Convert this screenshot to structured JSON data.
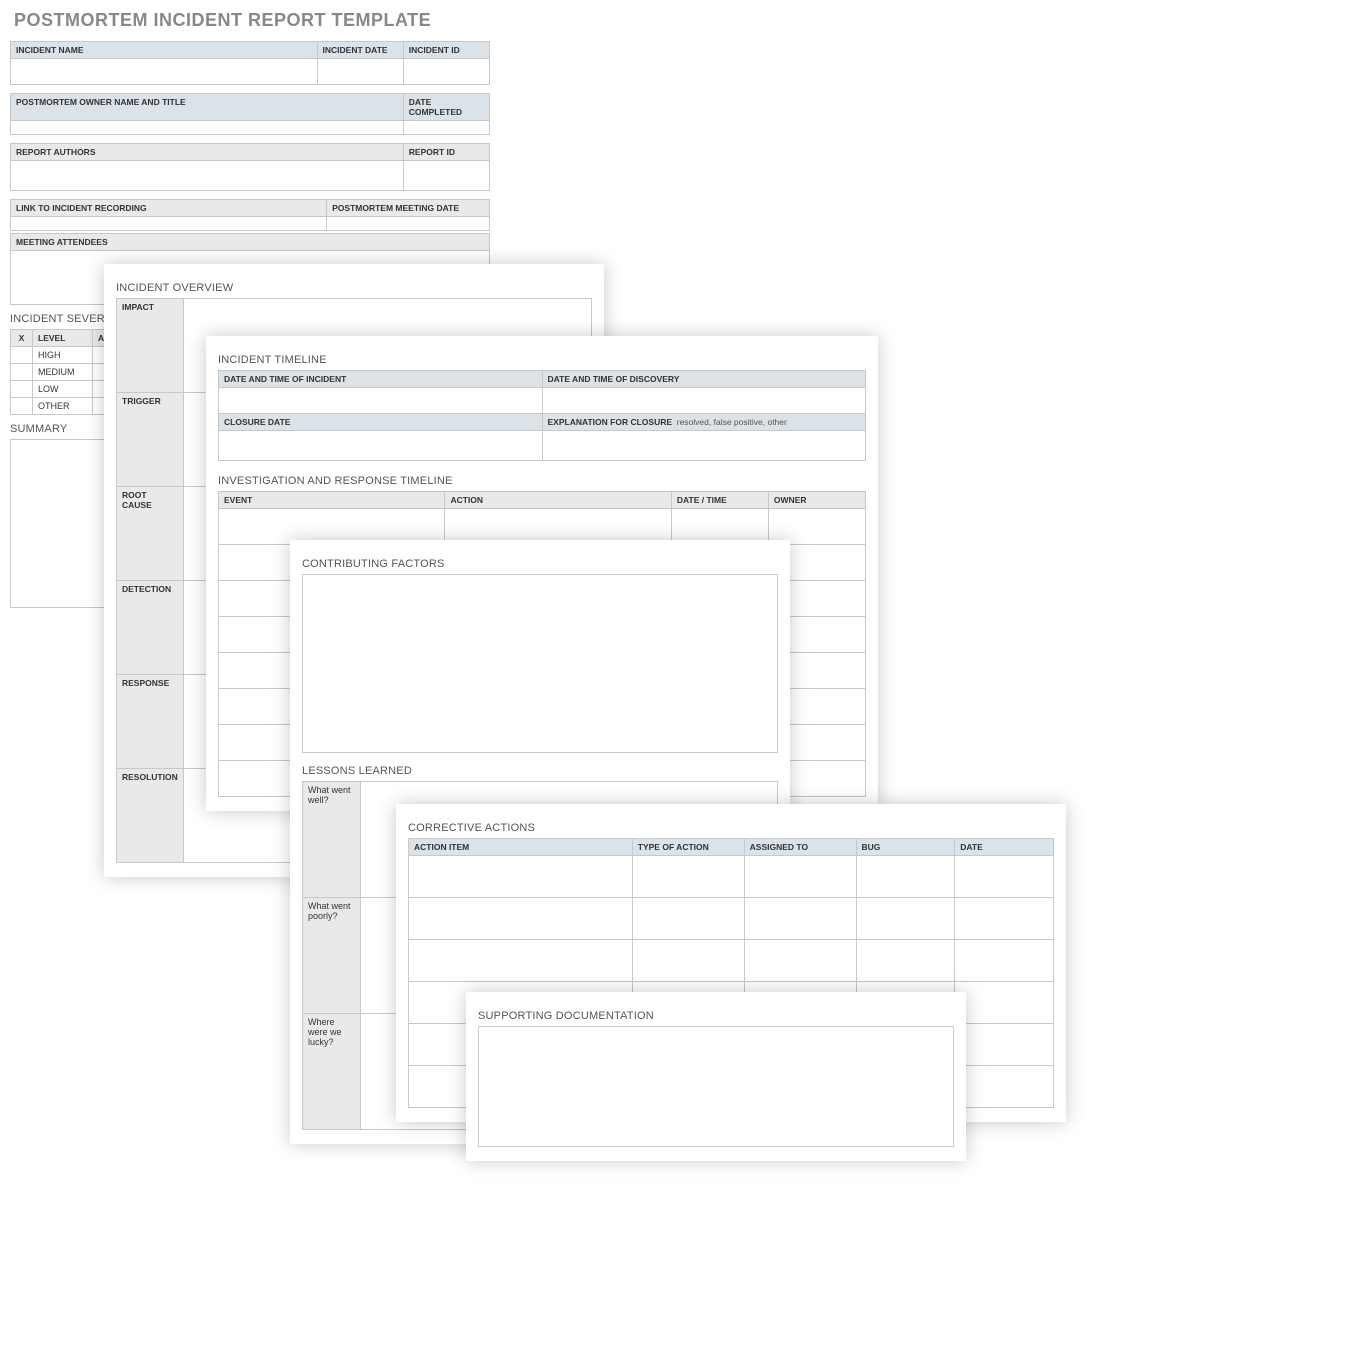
{
  "title": "POSTMORTEM INCIDENT REPORT TEMPLATE",
  "page1": {
    "incidentName": "INCIDENT NAME",
    "incidentDate": "INCIDENT DATE",
    "incidentId": "INCIDENT ID",
    "ownerName": "POSTMORTEM OWNER NAME AND TITLE",
    "dateCompleted": "DATE COMPLETED",
    "reportAuthors": "REPORT AUTHORS",
    "reportId": "REPORT ID",
    "linkRecording": "LINK TO INCIDENT RECORDING",
    "meetingDate": "POSTMORTEM MEETING DATE",
    "attendees": "MEETING ATTENDEES",
    "severityHeader": "INCIDENT SEVERITY",
    "sev": {
      "x": "X",
      "level": "LEVEL",
      "add": "ADD",
      "high": "HIGH",
      "medium": "MEDIUM",
      "low": "LOW",
      "other": "OTHER"
    },
    "summary": "SUMMARY"
  },
  "page2": {
    "header": "INCIDENT OVERVIEW",
    "impact": "IMPACT",
    "trigger": "TRIGGER",
    "rootCause": "ROOT CAUSE",
    "detection": "DETECTION",
    "response": "RESPONSE",
    "resolution": "RESOLUTION"
  },
  "page3": {
    "header": "INCIDENT TIMELINE",
    "dtIncident": "DATE AND TIME OF INCIDENT",
    "dtDiscovery": "DATE AND TIME OF DISCOVERY",
    "closureDate": "CLOSURE DATE",
    "explClosure": "EXPLANATION FOR CLOSURE",
    "explHint": "resolved, false positive, other",
    "invHeader": "INVESTIGATION AND RESPONSE TIMELINE",
    "event": "EVENT",
    "action": "ACTION",
    "datetime": "DATE / TIME",
    "owner": "OWNER"
  },
  "page4": {
    "contrib": "CONTRIBUTING FACTORS",
    "lessons": "LESSONS LEARNED",
    "wentWell": "What went well?",
    "wentPoorly": "What went poorly?",
    "lucky": "Where were we lucky?"
  },
  "page5": {
    "header": "CORRECTIVE ACTIONS",
    "actionItem": "ACTION ITEM",
    "typeAction": "TYPE OF ACTION",
    "assignedTo": "ASSIGNED TO",
    "bug": "BUG",
    "date": "DATE"
  },
  "page6": {
    "header": "SUPPORTING DOCUMENTATION"
  }
}
